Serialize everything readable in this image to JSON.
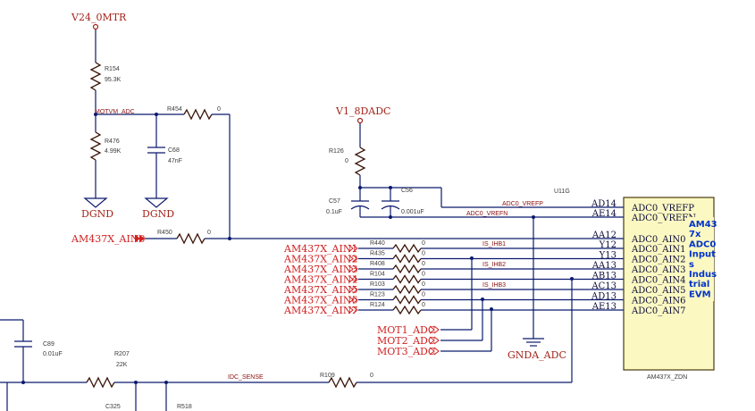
{
  "power": {
    "v24": "V24_0MTR",
    "v18": "V1_8DADC",
    "dgnd1": "DGND",
    "dgnd2": "DGND",
    "gnda": "GNDA_ADC"
  },
  "components": {
    "r154": {
      "ref": "R154",
      "value": "95.3K"
    },
    "r476": {
      "ref": "R476",
      "value": "4.99K"
    },
    "c68": {
      "ref": "C68",
      "value": "47nF"
    },
    "r454": {
      "ref": "R454",
      "value": "0"
    },
    "r450": {
      "ref": "R450",
      "value": "0"
    },
    "r126": {
      "ref": "R126",
      "value": "0"
    },
    "c57": {
      "ref": "C57",
      "value": "0.1uF"
    },
    "c56": {
      "ref": "C56",
      "value": "0.001uF"
    },
    "r440": {
      "ref": "R440",
      "value": "0"
    },
    "r435": {
      "ref": "R435",
      "value": "0"
    },
    "r408": {
      "ref": "R408",
      "value": "0"
    },
    "r104": {
      "ref": "R104",
      "value": "0"
    },
    "r103": {
      "ref": "R103",
      "value": "0"
    },
    "r123": {
      "ref": "R123",
      "value": "0"
    },
    "r124": {
      "ref": "R124",
      "value": "0"
    },
    "c89": {
      "ref": "C89",
      "value": "0.01uF"
    },
    "r207": {
      "ref": "R207",
      "value": "22K"
    },
    "r109": {
      "ref": "R109",
      "value": "0"
    },
    "c325": {
      "ref": "C325"
    },
    "r518": {
      "ref": "R518"
    }
  },
  "nets": {
    "motvm": "MOTVM_ADC",
    "vrefp": "ADC0_VREFP",
    "vrefn": "ADC0_VREFN",
    "ihb1": "IS_IHB1",
    "ihb2": "IS_IHB2",
    "ihb3": "IS_IHB3",
    "dcsense": "IDC_SENSE"
  },
  "ports": {
    "ain0": "AM437X_AIN0",
    "ain1": "AM437X_AIN1",
    "ain2": "AM437X_AIN2",
    "ain3": "AM437X_AIN3",
    "ain4": "AM437X_AIN4",
    "ain5": "AM437X_AIN5",
    "ain6": "AM437X_AIN6",
    "ain7": "AM437X_AIN7",
    "mot1": "MOT1_ADC",
    "mot2": "MOT2_ADC",
    "mot3": "MOT3_ADC"
  },
  "ic": {
    "ref": "U11G",
    "part": "AM437X_ZDN",
    "pins": [
      {
        "num": "AD14",
        "name": "ADC0_VREFP"
      },
      {
        "num": "AE14",
        "name": "ADC0_VREFN"
      },
      {
        "num": "AA12",
        "name": "ADC0_AIN0"
      },
      {
        "num": "Y12",
        "name": "ADC0_AIN1"
      },
      {
        "num": "Y13",
        "name": "ADC0_AIN2"
      },
      {
        "num": "AA13",
        "name": "ADC0_AIN3"
      },
      {
        "num": "AB13",
        "name": "ADC0_AIN4"
      },
      {
        "num": "AC13",
        "name": "ADC0_AIN5"
      },
      {
        "num": "AD13",
        "name": "ADC0_AIN6"
      },
      {
        "num": "AE13",
        "name": "ADC0_AIN7"
      }
    ],
    "note": [
      "AM43",
      "7x",
      "ADC0",
      "Input",
      "s",
      "Indus",
      "trial",
      "EVM"
    ]
  }
}
